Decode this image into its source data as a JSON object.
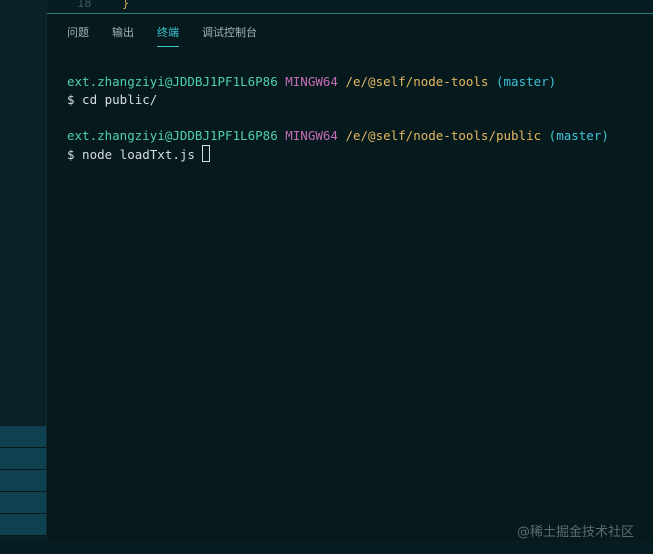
{
  "editor": {
    "line_number": "18",
    "line_text": "}"
  },
  "panel_tabs": [
    {
      "label": "问题"
    },
    {
      "label": "输出"
    },
    {
      "label": "终端",
      "active": true
    },
    {
      "label": "调试控制台"
    }
  ],
  "terminal": {
    "prompts": [
      {
        "user": "ext.zhangziyi@JDDBJ1PF1L6P86",
        "system": "MINGW64",
        "path": "/e/@self/node-tools",
        "branch": "(master)",
        "command": "$ cd public/"
      },
      {
        "user": "ext.zhangziyi@JDDBJ1PF1L6P86",
        "system": "MINGW64",
        "path": "/e/@self/node-tools/public",
        "branch": "(master)",
        "command": "$ node loadTxt.js "
      }
    ]
  },
  "watermark": "@稀土掘金技术社区",
  "colors": {
    "background": "#061a1e",
    "accent": "#3cc7cf",
    "user": "#4ed0a5",
    "system": "#c56bb5",
    "path": "#e6b65e"
  }
}
